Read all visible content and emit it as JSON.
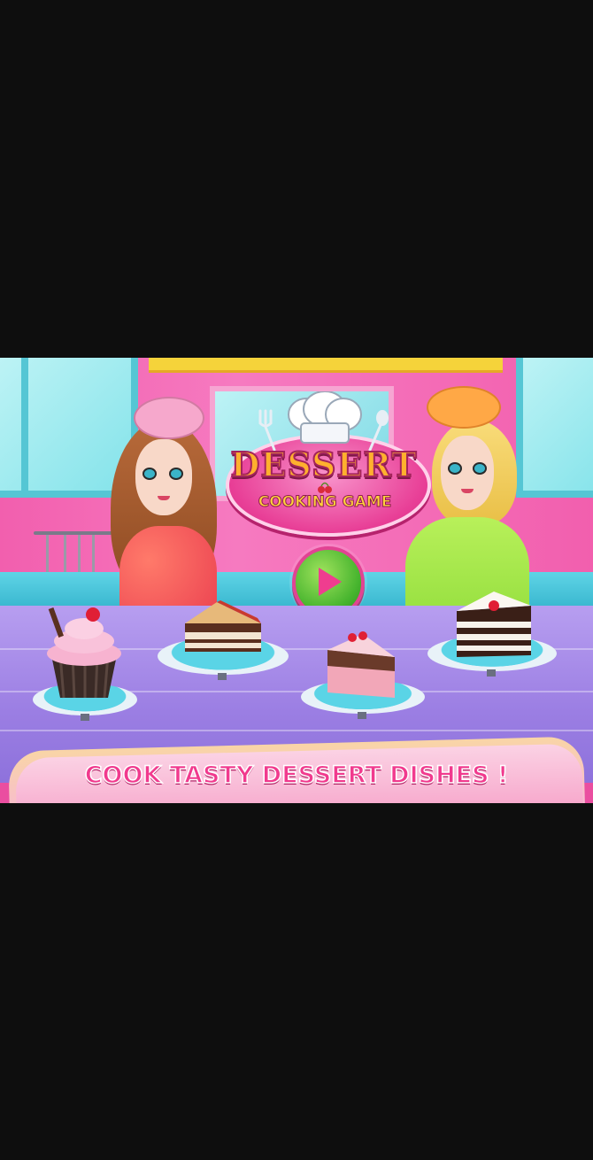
{
  "game": {
    "title": "DESSERT",
    "subtitle": "COOKING GAME",
    "tagline": "COOK TASTY DESSERT DISHES !"
  },
  "controls": {
    "play_icon": "play-icon"
  },
  "colors": {
    "letterbox": "#0e0e0e",
    "wall": "#f25fae",
    "counter": "#9b7ee3",
    "title_fill": "#ffb02e",
    "play_green": "#46b42e",
    "tagline": "#f13a8e"
  },
  "scene_items": [
    {
      "name": "cupcake",
      "icon": "cupcake-icon"
    },
    {
      "name": "cheesecake-slice",
      "icon": "cake-slice-icon"
    },
    {
      "name": "strawberry-cake-slice",
      "icon": "cake-slice-icon"
    },
    {
      "name": "layered-cream-cake",
      "icon": "cake-slice-icon"
    }
  ]
}
